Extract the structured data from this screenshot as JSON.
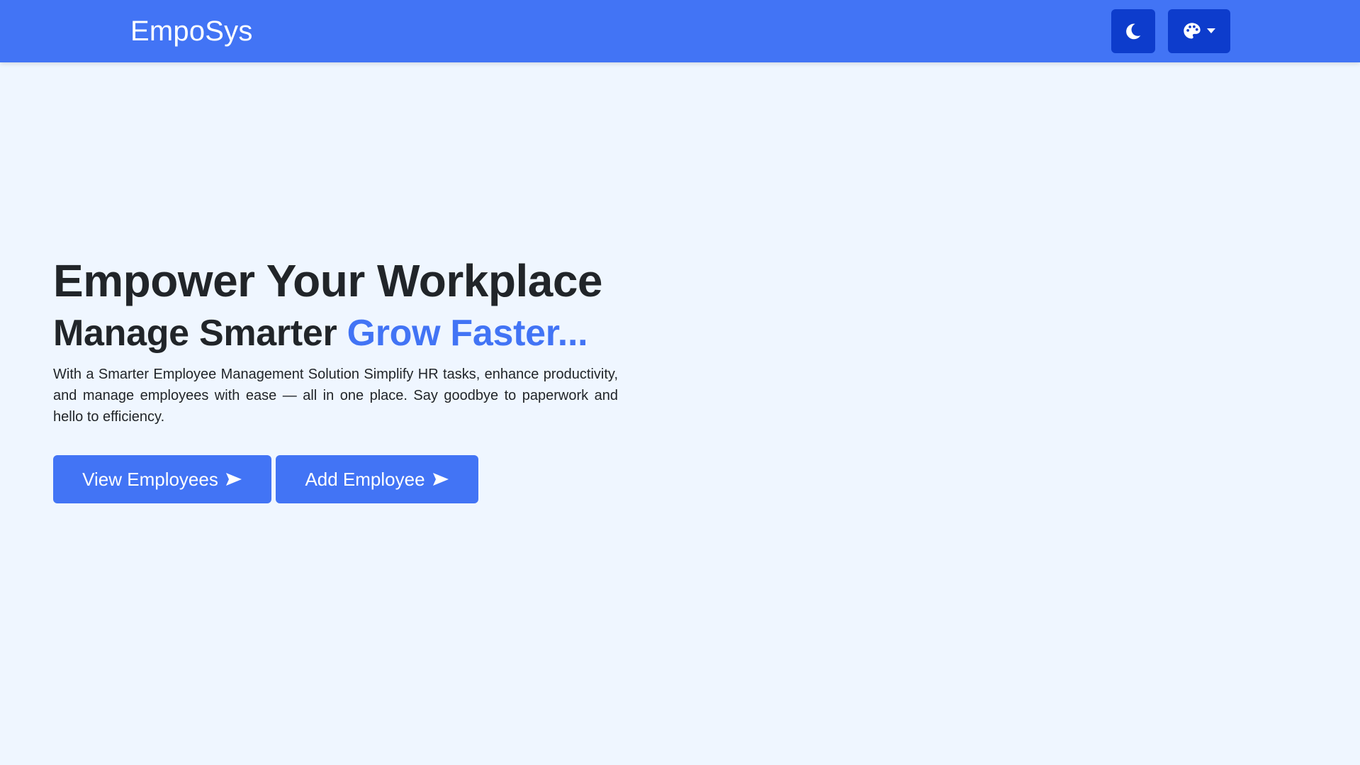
{
  "navbar": {
    "brand": "EmpoSys",
    "theme_toggle_icon": "moon-icon",
    "palette_icon": "palette-icon",
    "palette_caret_icon": "caret-down-icon",
    "bg_color": "#4274f5",
    "button_color": "#0d3ccc"
  },
  "hero": {
    "title": "Empower Your Workplace",
    "subtitle_prefix": "Manage Smarter ",
    "subtitle_accent": "Grow Faster...",
    "description": "With a Smarter Employee Management Solution Simplify HR tasks, enhance productivity, and manage employees with ease — all in one place. Say goodbye to paperwork and hello to efficiency.",
    "accent_color": "#4274f5"
  },
  "buttons": {
    "view_employees": "View Employees",
    "add_employee": "Add Employee",
    "arrow_icon": "arrow-right-icon"
  }
}
